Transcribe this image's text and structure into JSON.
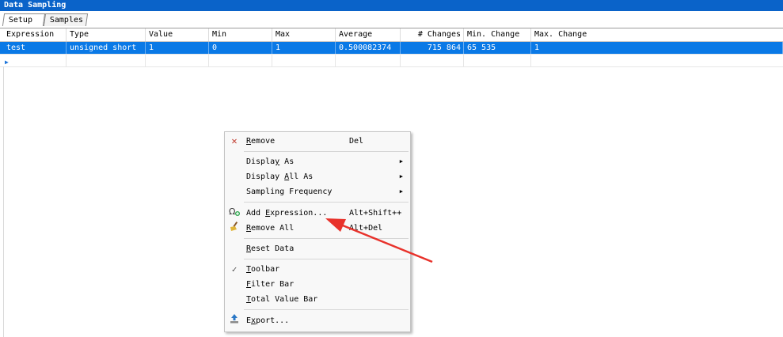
{
  "window": {
    "title": "Data Sampling"
  },
  "tabs": [
    "Setup",
    "Samples"
  ],
  "columns": [
    "Expression",
    "Type",
    "Value",
    "Min",
    "Max",
    "Average",
    "# Changes",
    "Min. Change",
    "Max. Change"
  ],
  "rows": [
    {
      "expression": "test",
      "type": "unsigned short",
      "value": "1",
      "min": "0",
      "max": "1",
      "average": "0.500082374",
      "changes": "715 864",
      "min_change": "65 535",
      "max_change": "1"
    }
  ],
  "context_menu": {
    "items": [
      {
        "pre": "",
        "key": "R",
        "post": "emove",
        "shortcut": "Del",
        "icon": "remove-x-icon"
      },
      {
        "pre": "Displa",
        "key": "y",
        "post": " As",
        "shortcut": "",
        "submenu": true
      },
      {
        "pre": "Display ",
        "key": "A",
        "post": "ll As",
        "shortcut": "",
        "submenu": true
      },
      {
        "pre": "Sampling Frequency",
        "key": "",
        "post": "",
        "shortcut": "",
        "submenu": true
      },
      {
        "pre": "Add ",
        "key": "E",
        "post": "xpression...",
        "shortcut": "Alt+Shift++",
        "icon": "add-expression-icon"
      },
      {
        "pre": "",
        "key": "R",
        "post": "emove All",
        "shortcut": "Alt+Del",
        "icon": "broom-icon"
      },
      {
        "pre": "",
        "key": "R",
        "post": "eset Data",
        "shortcut": ""
      },
      {
        "pre": "",
        "key": "T",
        "post": "oolbar",
        "shortcut": "",
        "checked": true
      },
      {
        "pre": "",
        "key": "F",
        "post": "ilter Bar",
        "shortcut": ""
      },
      {
        "pre": "",
        "key": "T",
        "post": "otal Value Bar",
        "shortcut": ""
      },
      {
        "pre": "E",
        "key": "x",
        "post": "port...",
        "shortcut": "",
        "icon": "export-icon"
      }
    ]
  },
  "colors": {
    "title_bar": "#0a63c9",
    "selection": "#0a79e6",
    "annotation_arrow": "#e8322b"
  }
}
